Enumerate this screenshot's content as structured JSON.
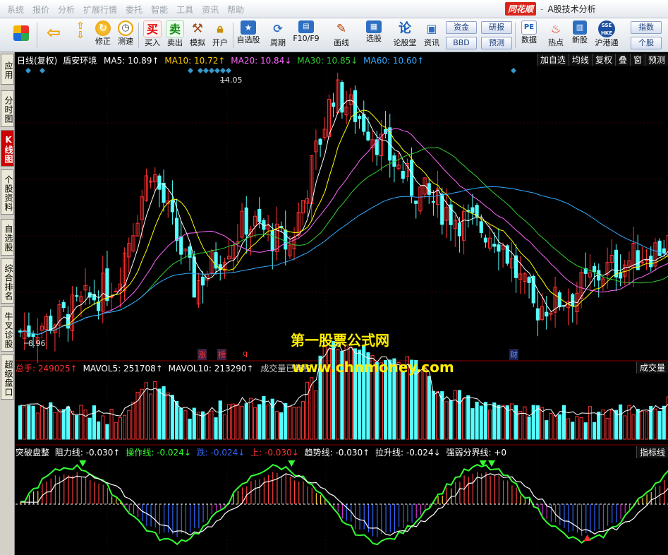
{
  "menu": [
    "系统",
    "报价",
    "分析",
    "扩展行情",
    "委托",
    "智能",
    "工具",
    "资讯",
    "帮助"
  ],
  "brand": {
    "logo": "同花顺",
    "separator": "-",
    "app_title": "A股技术分析"
  },
  "toolbar": {
    "buttons": [
      {
        "label": "",
        "icon": "windows-grid-icon"
      },
      {
        "label": "",
        "icon": "back-arrow-icon"
      },
      {
        "label": "",
        "icon": "up-down-arrows-icon"
      },
      {
        "label": "修正",
        "icon": "refresh-icon"
      },
      {
        "label": "测速",
        "icon": "clock-icon"
      },
      {
        "label": "买入",
        "glyph": "买"
      },
      {
        "label": "卖出",
        "glyph": "卖"
      },
      {
        "label": "模拟",
        "icon": "hammer-icon"
      },
      {
        "label": "开户",
        "icon": "lock-icon"
      },
      {
        "label": "自选股",
        "icon": "star-folder-icon"
      },
      {
        "label": "周期",
        "icon": "cycle-icon"
      },
      {
        "label": "F10/F9",
        "icon": "f10-icon"
      },
      {
        "label": "画线",
        "icon": "pen-icon"
      },
      {
        "label": "选股",
        "icon": "monitor-icon"
      },
      {
        "label": "论股堂",
        "glyph": "论"
      },
      {
        "label": "资讯",
        "icon": "news-icon"
      },
      {
        "label": "数据",
        "icon": "pe-icon"
      },
      {
        "label": "热点",
        "icon": "hot-icon"
      },
      {
        "label": "新股",
        "icon": "new-stock-icon"
      },
      {
        "label": "沪港通",
        "icon": "sse-hkex-icon"
      }
    ],
    "small_buttons": {
      "zijin": "资金",
      "bbd": "BBD",
      "yanbao": "研报",
      "yuce": "预测",
      "zhishu": "指数",
      "gegu": "个股"
    },
    "pe_text": "PE",
    "sse_text": "SSE HKE"
  },
  "left_tabs": [
    {
      "label": "应用",
      "active": false
    },
    {
      "label": "分时图",
      "active": false
    },
    {
      "label": "K线图",
      "active": true
    },
    {
      "label": "个股资料",
      "active": false
    },
    {
      "label": "自选股",
      "active": false
    },
    {
      "label": "综合排名",
      "active": false
    },
    {
      "label": "牛叉诊股",
      "active": false
    },
    {
      "label": "超级盘口",
      "active": false
    }
  ],
  "kline": {
    "period": "日线(复权)",
    "stock": "盾安环境",
    "ma": [
      {
        "label": "MA5: 10.89↑",
        "color": "#ffffff"
      },
      {
        "label": "MA10: 10.72↑",
        "color": "#ffcc00"
      },
      {
        "label": "MA20: 10.84↓",
        "color": "#ff66ff"
      },
      {
        "label": "MA30: 10.85↓",
        "color": "#33cc33"
      },
      {
        "label": "MA60: 10.60↑",
        "color": "#33aaff"
      }
    ],
    "high_label": "14.05",
    "low_label": "8.96",
    "price_high": 14.05,
    "price_low": 8.96,
    "markers": [
      "涨",
      "榜",
      "q",
      "财"
    ],
    "right_buttons": [
      "加自选",
      "均线",
      "复权",
      "叠",
      "窗",
      "预测"
    ]
  },
  "volume": {
    "total_label": "总手: 249025↑",
    "mavol5": "MAVOL5: 251708↑",
    "mavol10": "MAVOL10: 213290↑",
    "note": "成交量已复权",
    "right_button": "成交量"
  },
  "indicator": {
    "name": "突破盘整",
    "items": [
      {
        "label": "阻力线: -0.030↑",
        "color": "#ffffff"
      },
      {
        "label": "操作线: -0.024↓",
        "color": "#33ff33"
      },
      {
        "label": "跌: -0.024↓",
        "color": "#3366ff"
      },
      {
        "label": "上: -0.030↓",
        "color": "#ff3333"
      },
      {
        "label": "趋势线: -0.030↑",
        "color": "#ffffff"
      },
      {
        "label": "拉升线: -0.024↓",
        "color": "#ffffff"
      },
      {
        "label": "强弱分界线: +0",
        "color": "#ffffff"
      }
    ],
    "right_button": "指标线"
  },
  "watermark": {
    "line1": "第一股票公式网",
    "line2": "www.chnmoney.com"
  },
  "colors": {
    "up": "#ff3232",
    "down": "#54ffff",
    "ma5": "#ffffff",
    "ma10": "#ffff00",
    "ma20": "#ff66ff",
    "ma30": "#33cc33",
    "ma60": "#33aaff"
  }
}
